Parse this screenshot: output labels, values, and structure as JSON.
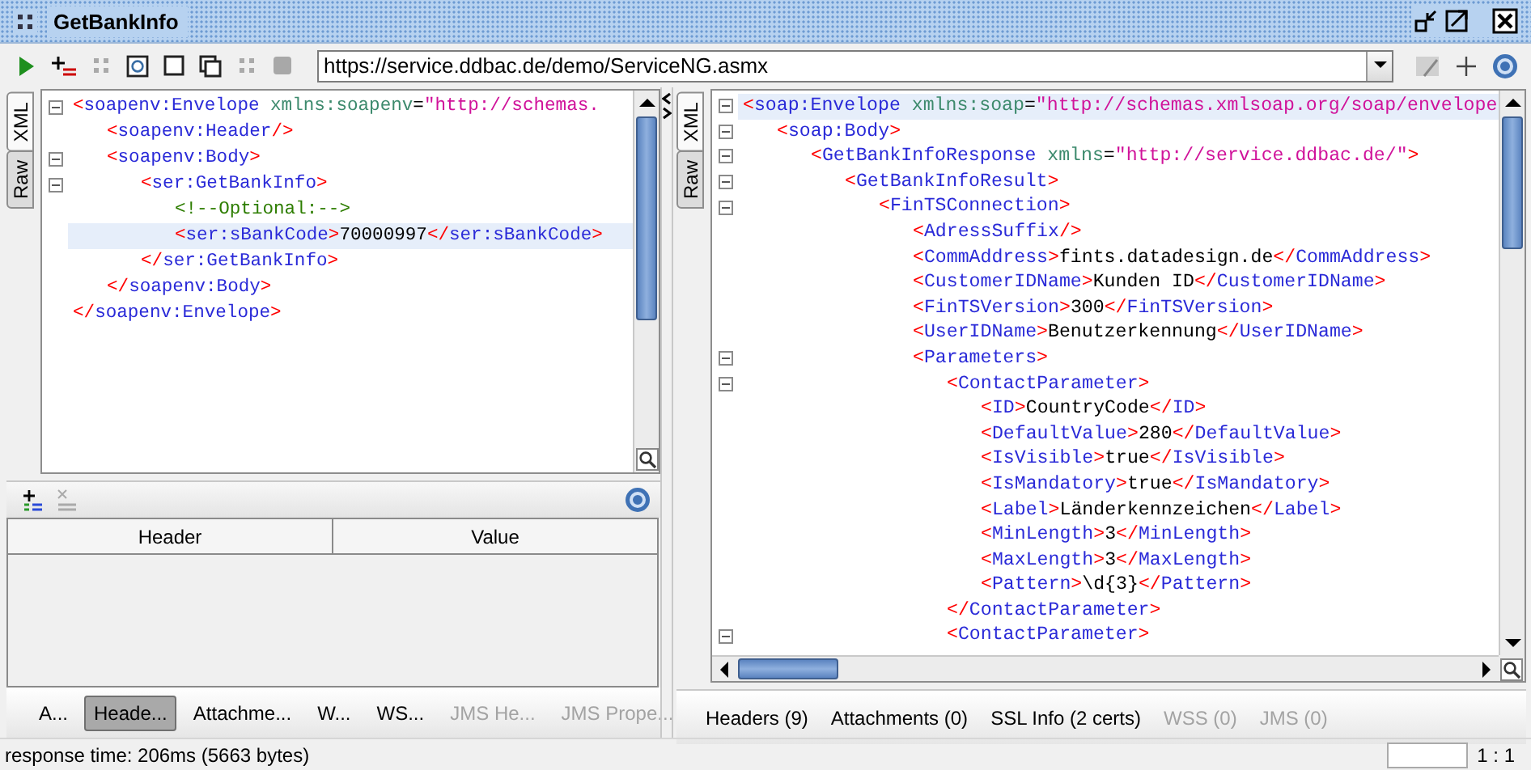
{
  "window": {
    "title": "GetBankInfo"
  },
  "toolbar": {
    "endpoint": "https://service.ddbac.de/demo/ServiceNG.asmx"
  },
  "request": {
    "view_tabs": [
      {
        "label": "XML",
        "selected": true
      },
      {
        "label": "Raw",
        "selected": false
      }
    ],
    "xml_lines": [
      {
        "fold": true,
        "highlighted": false,
        "tokens": [
          {
            "kind": "punct",
            "text": "<"
          },
          {
            "kind": "tag",
            "text": "soapenv:Envelope"
          },
          {
            "kind": "attr",
            "text": " xmlns:soapenv"
          },
          {
            "kind": "text",
            "text": "="
          },
          {
            "kind": "value",
            "text": "\"http://schemas."
          }
        ],
        "children": [
          {
            "fold": false,
            "highlighted": false,
            "tokens": [
              {
                "kind": "punct",
                "text": "<"
              },
              {
                "kind": "tag",
                "text": "soapenv:Header"
              },
              {
                "kind": "punct",
                "text": "/>"
              }
            ]
          },
          {
            "fold": true,
            "highlighted": false,
            "tokens": [
              {
                "kind": "punct",
                "text": "<"
              },
              {
                "kind": "tag",
                "text": "soapenv:Body"
              },
              {
                "kind": "punct",
                "text": ">"
              }
            ],
            "children": [
              {
                "fold": true,
                "highlighted": false,
                "tokens": [
                  {
                    "kind": "punct",
                    "text": "<"
                  },
                  {
                    "kind": "tag",
                    "text": "ser:GetBankInfo"
                  },
                  {
                    "kind": "punct",
                    "text": ">"
                  }
                ],
                "children": [
                  {
                    "fold": false,
                    "highlighted": false,
                    "tokens": [
                      {
                        "kind": "comment",
                        "text": "<!--Optional:-->"
                      }
                    ]
                  },
                  {
                    "fold": false,
                    "highlighted": true,
                    "tokens": [
                      {
                        "kind": "punct",
                        "text": "<"
                      },
                      {
                        "kind": "tag",
                        "text": "ser:sBankCode"
                      },
                      {
                        "kind": "punct",
                        "text": ">"
                      },
                      {
                        "kind": "text",
                        "text": "70000997"
                      },
                      {
                        "kind": "punct",
                        "text": "</"
                      },
                      {
                        "kind": "tag",
                        "text": "ser:sBankCode"
                      },
                      {
                        "kind": "punct",
                        "text": ">"
                      }
                    ]
                  }
                ]
              },
              {
                "fold": false,
                "highlighted": false,
                "tokens": [
                  {
                    "kind": "punct",
                    "text": "</"
                  },
                  {
                    "kind": "tag",
                    "text": "ser:GetBankInfo"
                  },
                  {
                    "kind": "punct",
                    "text": ">"
                  }
                ]
              }
            ]
          },
          {
            "fold": false,
            "highlighted": false,
            "tokens": [
              {
                "kind": "punct",
                "text": "</"
              },
              {
                "kind": "tag",
                "text": "soapenv:Body"
              },
              {
                "kind": "punct",
                "text": ">"
              }
            ]
          }
        ]
      },
      {
        "fold": false,
        "highlighted": false,
        "tokens": [
          {
            "kind": "punct",
            "text": "</"
          },
          {
            "kind": "tag",
            "text": "soapenv:Envelope"
          },
          {
            "kind": "punct",
            "text": ">"
          }
        ]
      }
    ],
    "headers_table": {
      "columns": [
        "Header",
        "Value"
      ]
    },
    "tabs": [
      {
        "label": "A...",
        "selected": false,
        "disabled": false
      },
      {
        "label": "Heade...",
        "selected": true,
        "disabled": false
      },
      {
        "label": "Attachme...",
        "selected": false,
        "disabled": false
      },
      {
        "label": "W...",
        "selected": false,
        "disabled": false
      },
      {
        "label": "WS...",
        "selected": false,
        "disabled": false
      },
      {
        "label": "JMS He...",
        "selected": false,
        "disabled": true
      },
      {
        "label": "JMS Prope...",
        "selected": false,
        "disabled": true
      }
    ]
  },
  "response": {
    "view_tabs": [
      {
        "label": "XML",
        "selected": true
      },
      {
        "label": "Raw",
        "selected": false
      }
    ],
    "xml_lines": [
      {
        "fold": true,
        "highlighted": true,
        "tokens": [
          {
            "kind": "punct",
            "text": "<"
          },
          {
            "kind": "tag",
            "text": "soap:Envelope"
          },
          {
            "kind": "attr",
            "text": " xmlns:soap"
          },
          {
            "kind": "text",
            "text": "="
          },
          {
            "kind": "value",
            "text": "\"http://schemas.xmlsoap.org/soap/envelope"
          }
        ],
        "children": [
          {
            "fold": true,
            "highlighted": false,
            "tokens": [
              {
                "kind": "punct",
                "text": "<"
              },
              {
                "kind": "tag",
                "text": "soap:Body"
              },
              {
                "kind": "punct",
                "text": ">"
              }
            ],
            "children": [
              {
                "fold": true,
                "highlighted": false,
                "tokens": [
                  {
                    "kind": "punct",
                    "text": "<"
                  },
                  {
                    "kind": "tag",
                    "text": "GetBankInfoResponse"
                  },
                  {
                    "kind": "attr",
                    "text": " xmlns"
                  },
                  {
                    "kind": "text",
                    "text": "="
                  },
                  {
                    "kind": "value",
                    "text": "\"http://service.ddbac.de/\""
                  },
                  {
                    "kind": "punct",
                    "text": ">"
                  }
                ],
                "children": [
                  {
                    "fold": true,
                    "highlighted": false,
                    "tokens": [
                      {
                        "kind": "punct",
                        "text": "<"
                      },
                      {
                        "kind": "tag",
                        "text": "GetBankInfoResult"
                      },
                      {
                        "kind": "punct",
                        "text": ">"
                      }
                    ],
                    "children": [
                      {
                        "fold": true,
                        "highlighted": false,
                        "tokens": [
                          {
                            "kind": "punct",
                            "text": "<"
                          },
                          {
                            "kind": "tag",
                            "text": "FinTSConnection"
                          },
                          {
                            "kind": "punct",
                            "text": ">"
                          }
                        ],
                        "children": [
                          {
                            "fold": false,
                            "highlighted": false,
                            "tokens": [
                              {
                                "kind": "punct",
                                "text": "<"
                              },
                              {
                                "kind": "tag",
                                "text": "AdressSuffix"
                              },
                              {
                                "kind": "punct",
                                "text": "/>"
                              }
                            ]
                          },
                          {
                            "fold": false,
                            "highlighted": false,
                            "tokens": [
                              {
                                "kind": "punct",
                                "text": "<"
                              },
                              {
                                "kind": "tag",
                                "text": "CommAddress"
                              },
                              {
                                "kind": "punct",
                                "text": ">"
                              },
                              {
                                "kind": "text",
                                "text": "fints.datadesign.de"
                              },
                              {
                                "kind": "punct",
                                "text": "</"
                              },
                              {
                                "kind": "tag",
                                "text": "CommAddress"
                              },
                              {
                                "kind": "punct",
                                "text": ">"
                              }
                            ]
                          },
                          {
                            "fold": false,
                            "highlighted": false,
                            "tokens": [
                              {
                                "kind": "punct",
                                "text": "<"
                              },
                              {
                                "kind": "tag",
                                "text": "CustomerIDName"
                              },
                              {
                                "kind": "punct",
                                "text": ">"
                              },
                              {
                                "kind": "text",
                                "text": "Kunden ID"
                              },
                              {
                                "kind": "punct",
                                "text": "</"
                              },
                              {
                                "kind": "tag",
                                "text": "CustomerIDName"
                              },
                              {
                                "kind": "punct",
                                "text": ">"
                              }
                            ]
                          },
                          {
                            "fold": false,
                            "highlighted": false,
                            "tokens": [
                              {
                                "kind": "punct",
                                "text": "<"
                              },
                              {
                                "kind": "tag",
                                "text": "FinTSVersion"
                              },
                              {
                                "kind": "punct",
                                "text": ">"
                              },
                              {
                                "kind": "text",
                                "text": "300"
                              },
                              {
                                "kind": "punct",
                                "text": "</"
                              },
                              {
                                "kind": "tag",
                                "text": "FinTSVersion"
                              },
                              {
                                "kind": "punct",
                                "text": ">"
                              }
                            ]
                          },
                          {
                            "fold": false,
                            "highlighted": false,
                            "tokens": [
                              {
                                "kind": "punct",
                                "text": "<"
                              },
                              {
                                "kind": "tag",
                                "text": "UserIDName"
                              },
                              {
                                "kind": "punct",
                                "text": ">"
                              },
                              {
                                "kind": "text",
                                "text": "Benutzerkennung"
                              },
                              {
                                "kind": "punct",
                                "text": "</"
                              },
                              {
                                "kind": "tag",
                                "text": "UserIDName"
                              },
                              {
                                "kind": "punct",
                                "text": ">"
                              }
                            ]
                          },
                          {
                            "fold": true,
                            "highlighted": false,
                            "tokens": [
                              {
                                "kind": "punct",
                                "text": "<"
                              },
                              {
                                "kind": "tag",
                                "text": "Parameters"
                              },
                              {
                                "kind": "punct",
                                "text": ">"
                              }
                            ],
                            "children": [
                              {
                                "fold": true,
                                "highlighted": false,
                                "tokens": [
                                  {
                                    "kind": "punct",
                                    "text": "<"
                                  },
                                  {
                                    "kind": "tag",
                                    "text": "ContactParameter"
                                  },
                                  {
                                    "kind": "punct",
                                    "text": ">"
                                  }
                                ],
                                "children": [
                                  {
                                    "fold": false,
                                    "highlighted": false,
                                    "tokens": [
                                      {
                                        "kind": "punct",
                                        "text": "<"
                                      },
                                      {
                                        "kind": "tag",
                                        "text": "ID"
                                      },
                                      {
                                        "kind": "punct",
                                        "text": ">"
                                      },
                                      {
                                        "kind": "text",
                                        "text": "CountryCode"
                                      },
                                      {
                                        "kind": "punct",
                                        "text": "</"
                                      },
                                      {
                                        "kind": "tag",
                                        "text": "ID"
                                      },
                                      {
                                        "kind": "punct",
                                        "text": ">"
                                      }
                                    ]
                                  },
                                  {
                                    "fold": false,
                                    "highlighted": false,
                                    "tokens": [
                                      {
                                        "kind": "punct",
                                        "text": "<"
                                      },
                                      {
                                        "kind": "tag",
                                        "text": "DefaultValue"
                                      },
                                      {
                                        "kind": "punct",
                                        "text": ">"
                                      },
                                      {
                                        "kind": "text",
                                        "text": "280"
                                      },
                                      {
                                        "kind": "punct",
                                        "text": "</"
                                      },
                                      {
                                        "kind": "tag",
                                        "text": "DefaultValue"
                                      },
                                      {
                                        "kind": "punct",
                                        "text": ">"
                                      }
                                    ]
                                  },
                                  {
                                    "fold": false,
                                    "highlighted": false,
                                    "tokens": [
                                      {
                                        "kind": "punct",
                                        "text": "<"
                                      },
                                      {
                                        "kind": "tag",
                                        "text": "IsVisible"
                                      },
                                      {
                                        "kind": "punct",
                                        "text": ">"
                                      },
                                      {
                                        "kind": "text",
                                        "text": "true"
                                      },
                                      {
                                        "kind": "punct",
                                        "text": "</"
                                      },
                                      {
                                        "kind": "tag",
                                        "text": "IsVisible"
                                      },
                                      {
                                        "kind": "punct",
                                        "text": ">"
                                      }
                                    ]
                                  },
                                  {
                                    "fold": false,
                                    "highlighted": false,
                                    "tokens": [
                                      {
                                        "kind": "punct",
                                        "text": "<"
                                      },
                                      {
                                        "kind": "tag",
                                        "text": "IsMandatory"
                                      },
                                      {
                                        "kind": "punct",
                                        "text": ">"
                                      },
                                      {
                                        "kind": "text",
                                        "text": "true"
                                      },
                                      {
                                        "kind": "punct",
                                        "text": "</"
                                      },
                                      {
                                        "kind": "tag",
                                        "text": "IsMandatory"
                                      },
                                      {
                                        "kind": "punct",
                                        "text": ">"
                                      }
                                    ]
                                  },
                                  {
                                    "fold": false,
                                    "highlighted": false,
                                    "tokens": [
                                      {
                                        "kind": "punct",
                                        "text": "<"
                                      },
                                      {
                                        "kind": "tag",
                                        "text": "Label"
                                      },
                                      {
                                        "kind": "punct",
                                        "text": ">"
                                      },
                                      {
                                        "kind": "text",
                                        "text": "Länderkennzeichen"
                                      },
                                      {
                                        "kind": "punct",
                                        "text": "</"
                                      },
                                      {
                                        "kind": "tag",
                                        "text": "Label"
                                      },
                                      {
                                        "kind": "punct",
                                        "text": ">"
                                      }
                                    ]
                                  },
                                  {
                                    "fold": false,
                                    "highlighted": false,
                                    "tokens": [
                                      {
                                        "kind": "punct",
                                        "text": "<"
                                      },
                                      {
                                        "kind": "tag",
                                        "text": "MinLength"
                                      },
                                      {
                                        "kind": "punct",
                                        "text": ">"
                                      },
                                      {
                                        "kind": "text",
                                        "text": "3"
                                      },
                                      {
                                        "kind": "punct",
                                        "text": "</"
                                      },
                                      {
                                        "kind": "tag",
                                        "text": "MinLength"
                                      },
                                      {
                                        "kind": "punct",
                                        "text": ">"
                                      }
                                    ]
                                  },
                                  {
                                    "fold": false,
                                    "highlighted": false,
                                    "tokens": [
                                      {
                                        "kind": "punct",
                                        "text": "<"
                                      },
                                      {
                                        "kind": "tag",
                                        "text": "MaxLength"
                                      },
                                      {
                                        "kind": "punct",
                                        "text": ">"
                                      },
                                      {
                                        "kind": "text",
                                        "text": "3"
                                      },
                                      {
                                        "kind": "punct",
                                        "text": "</"
                                      },
                                      {
                                        "kind": "tag",
                                        "text": "MaxLength"
                                      },
                                      {
                                        "kind": "punct",
                                        "text": ">"
                                      }
                                    ]
                                  },
                                  {
                                    "fold": false,
                                    "highlighted": false,
                                    "tokens": [
                                      {
                                        "kind": "punct",
                                        "text": "<"
                                      },
                                      {
                                        "kind": "tag",
                                        "text": "Pattern"
                                      },
                                      {
                                        "kind": "punct",
                                        "text": ">"
                                      },
                                      {
                                        "kind": "text",
                                        "text": "\\d{3}"
                                      },
                                      {
                                        "kind": "punct",
                                        "text": "</"
                                      },
                                      {
                                        "kind": "tag",
                                        "text": "Pattern"
                                      },
                                      {
                                        "kind": "punct",
                                        "text": ">"
                                      }
                                    ]
                                  }
                                ]
                              },
                              {
                                "fold": false,
                                "highlighted": false,
                                "tokens": [
                                  {
                                    "kind": "punct",
                                    "text": "</"
                                  },
                                  {
                                    "kind": "tag",
                                    "text": "ContactParameter"
                                  },
                                  {
                                    "kind": "punct",
                                    "text": ">"
                                  }
                                ]
                              },
                              {
                                "fold": true,
                                "highlighted": false,
                                "tokens": [
                                  {
                                    "kind": "punct",
                                    "text": "<"
                                  },
                                  {
                                    "kind": "tag",
                                    "text": "ContactParameter"
                                  },
                                  {
                                    "kind": "punct",
                                    "text": ">"
                                  }
                                ]
                              }
                            ]
                          }
                        ]
                      }
                    ]
                  }
                ]
              }
            ]
          }
        ]
      }
    ],
    "tabs": [
      {
        "label": "Headers (9)",
        "selected": false,
        "disabled": false
      },
      {
        "label": "Attachments (0)",
        "selected": false,
        "disabled": false
      },
      {
        "label": "SSL Info (2 certs)",
        "selected": false,
        "disabled": false
      },
      {
        "label": "WSS (0)",
        "selected": false,
        "disabled": true
      },
      {
        "label": "JMS (0)",
        "selected": false,
        "disabled": true
      }
    ]
  },
  "status_bar": {
    "text": "response time: 206ms (5663 bytes)",
    "position": "1 : 1"
  }
}
